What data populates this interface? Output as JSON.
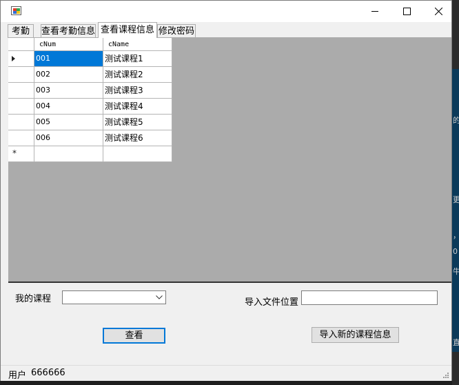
{
  "tabs": [
    {
      "label": "考勤"
    },
    {
      "label": "查看考勤信息"
    },
    {
      "label": "查看课程信息"
    },
    {
      "label": "修改密码"
    }
  ],
  "grid": {
    "columns": [
      "cNum",
      "cName"
    ],
    "rows": [
      {
        "cNum": "001",
        "cName": "测试课程1"
      },
      {
        "cNum": "002",
        "cName": "测试课程2"
      },
      {
        "cNum": "003",
        "cName": "测试课程3"
      },
      {
        "cNum": "004",
        "cName": "测试课程4"
      },
      {
        "cNum": "005",
        "cName": "测试课程5"
      },
      {
        "cNum": "006",
        "cName": "测试课程6"
      }
    ],
    "new_row_marker": "*"
  },
  "form": {
    "my_course_label": "我的课程",
    "my_course_value": "",
    "import_path_label": "导入文件位置",
    "import_path_value": "",
    "view_button": "查看",
    "import_button": "导入新的课程信息"
  },
  "status": {
    "user_label": "用户",
    "user_value": "666666"
  },
  "desktop_fragments": [
    "的",
    "更",
    "，",
    "0",
    "牛",
    "直"
  ],
  "colors": {
    "selection": "#0078d7",
    "grid_background": "#ababab"
  }
}
